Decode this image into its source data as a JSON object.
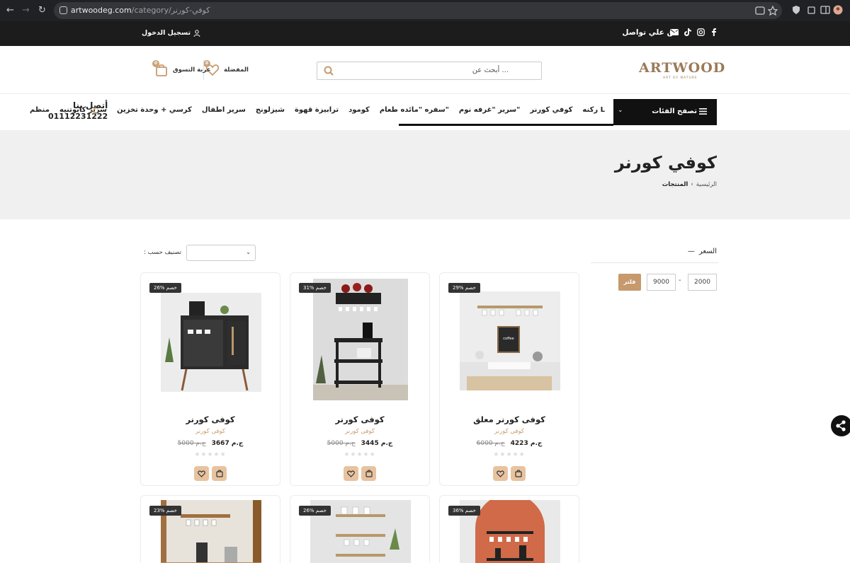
{
  "browser": {
    "url_domain": "artwoodeg.com",
    "url_path": "/category/كوفي-كورنر"
  },
  "topbar": {
    "contact_label": "كن علي تواصل",
    "login_label": "تسجيل الدخول",
    "social_icons": [
      "facebook-icon",
      "instagram-icon",
      "tiktok-icon",
      "mail-icon"
    ]
  },
  "header": {
    "logo_text": "ARTWOOD",
    "logo_tagline": "ART OF NATURE",
    "search_placeholder": "أبحث عن ...",
    "favorites_label": "المفضلة",
    "favorites_count": "0",
    "cart_label": "عربة التسوق",
    "cart_count": "0"
  },
  "nav": {
    "categories_button": "تصفح الفئات",
    "items": [
      "ركنه L",
      "كوفي كورنر",
      "سرير \"غرفه نوم\"",
      "سفره \"مائده طعام\"",
      "كومود",
      "ترابيزة قهوة",
      "شيزلونج",
      "سرير اطفال",
      "كرسي + وحدة تخزين",
      "سرير كابوتنيه",
      "منظم"
    ],
    "contact_title": "أتصل بنا",
    "contact_phone": "01112231222"
  },
  "page": {
    "title": "كوفي كورنر",
    "breadcrumb_home": "الرئيسية",
    "breadcrumb_current": "المنتجات"
  },
  "filter": {
    "title": "السعر",
    "min": "2000",
    "max": "9000",
    "button": "فلتر"
  },
  "sort": {
    "label": ": تصنيف حسب"
  },
  "products": [
    {
      "name": "كوفى كورنر معلق",
      "category": "كوفى كورنر",
      "price": "4223 ج.م",
      "old_price": "6000 ج.م",
      "discount": "29% خصم"
    },
    {
      "name": "كوفى كورنر",
      "category": "كوفى كورنر",
      "price": "3445 ج.م",
      "old_price": "5000 ج.م",
      "discount": "31% خصم"
    },
    {
      "name": "كوفى كورنر",
      "category": "كوفى كورنر",
      "price": "3667 ج.م",
      "old_price": "5000 ج.م",
      "discount": "26% خصم"
    },
    {
      "discount": "36% خصم"
    },
    {
      "discount": "26% خصم"
    },
    {
      "discount": "23% خصم"
    }
  ],
  "colors": {
    "accent": "#c69a6d",
    "dark": "#1c1c1c"
  }
}
